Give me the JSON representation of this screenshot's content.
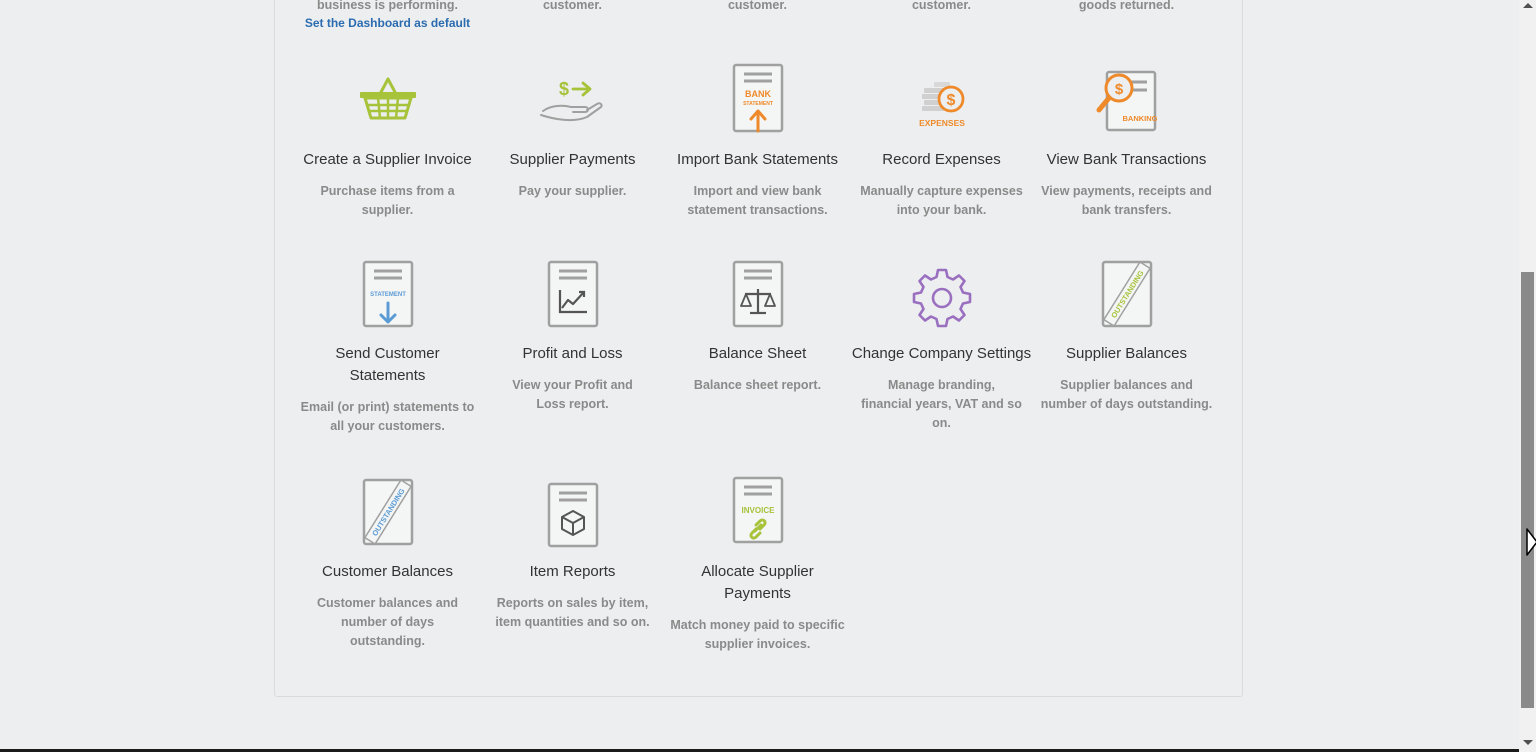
{
  "top_fragments": {
    "col1": "business is performing.",
    "col2": "customer.",
    "col3": "customer.",
    "col4": "customer.",
    "col5": "goods returned."
  },
  "default_link": "Set the Dashboard as default",
  "tiles": [
    {
      "title": "Create a Supplier Invoice",
      "desc": "Purchase items from a supplier."
    },
    {
      "title": "Supplier Payments",
      "desc": "Pay your supplier."
    },
    {
      "title": "Import Bank Statements",
      "desc": "Import and view bank statement transactions."
    },
    {
      "title": "Record Expenses",
      "desc": "Manually capture expenses into your bank."
    },
    {
      "title": "View Bank Transactions",
      "desc": "View payments, receipts and bank transfers."
    },
    {
      "title": "Send Customer Statements",
      "desc": "Email (or print) statements to all your customers."
    },
    {
      "title": "Profit and Loss",
      "desc": "View your Profit and Loss report."
    },
    {
      "title": "Balance Sheet",
      "desc": "Balance sheet report."
    },
    {
      "title": "Change Company Settings",
      "desc": "Manage branding, financial years, VAT and so on."
    },
    {
      "title": "Supplier Balances",
      "desc": "Supplier balances and number of days outstanding."
    },
    {
      "title": "Customer Balances",
      "desc": "Customer balances and number of days outstanding."
    },
    {
      "title": "Item Reports",
      "desc": "Reports on sales by item, item quantities and so on."
    },
    {
      "title": "Allocate Supplier Payments",
      "desc": "Match money paid to specific supplier invoices."
    }
  ],
  "icon_text": {
    "bank": "BANK",
    "statement": "STATEMENT",
    "expenses": "EXPENSES",
    "banking": "BANKING",
    "outstanding": "OUTSTANDING",
    "invoice": "INVOICE",
    "dollar": "$"
  },
  "colors": {
    "green": "#a6c33a",
    "orange": "#ef8a2a",
    "blue": "#5b9bd5",
    "purple": "#9a6fc0",
    "gray": "#a0a0a0",
    "link": "#2b6cb0"
  }
}
